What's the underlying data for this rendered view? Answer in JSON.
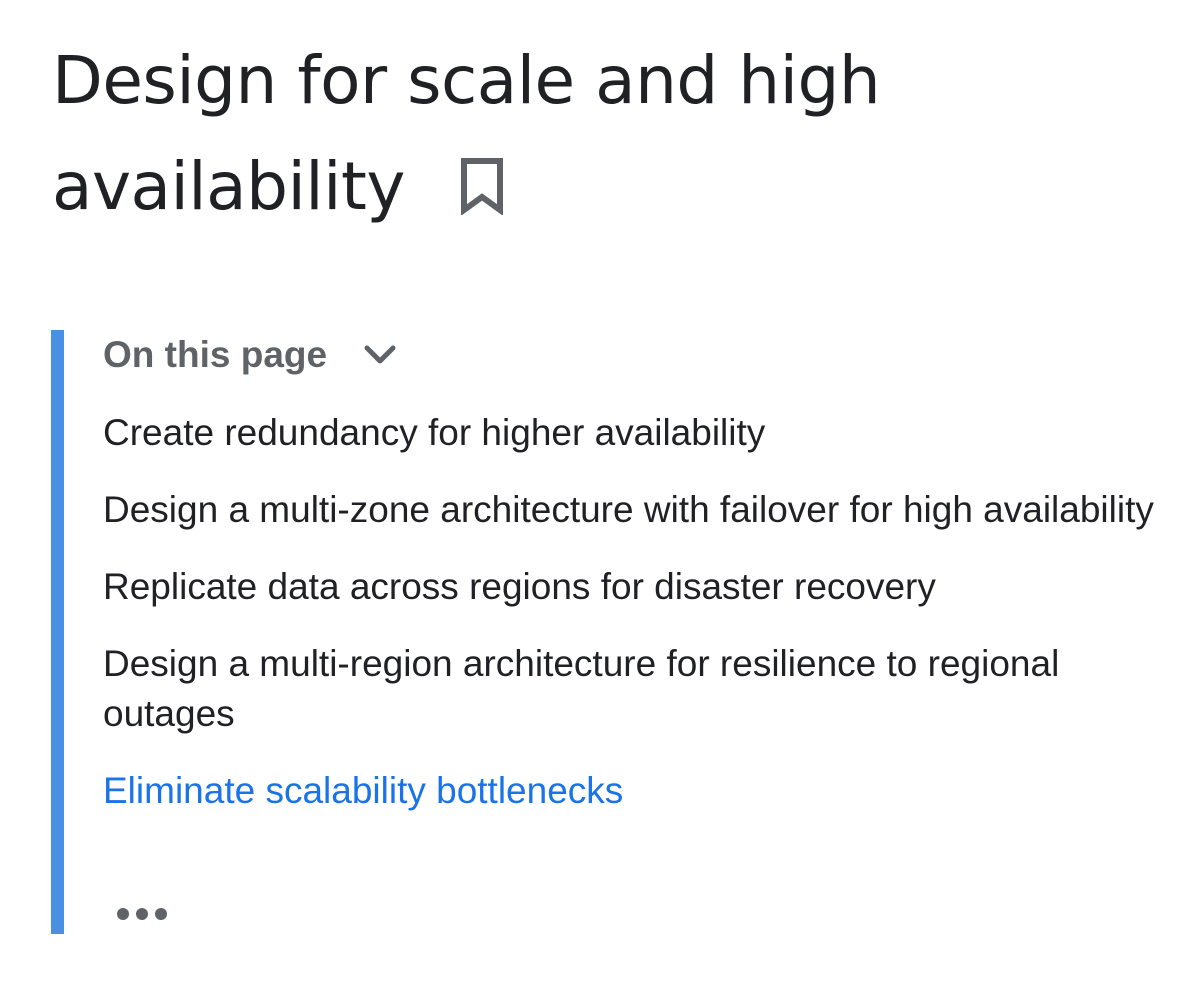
{
  "page": {
    "title": "Design for scale and high availability"
  },
  "icons": {
    "bookmark": "bookmark-outline-icon",
    "chevron": "chevron-down-icon",
    "more": "more-horizontal-icon"
  },
  "toc": {
    "header_label": "On this page",
    "items": [
      {
        "label": "Create redundancy for higher availability",
        "active": false
      },
      {
        "label": "Design a multi-zone architecture with failover for high availability",
        "active": false
      },
      {
        "label": "Replicate data across regions for disaster recovery",
        "active": false
      },
      {
        "label": "Design a multi-region architecture for resilience to regional outages",
        "active": false
      },
      {
        "label": "Eliminate scalability bottlenecks",
        "active": true
      }
    ]
  },
  "colors": {
    "accent_bar": "#4a90e2",
    "active_link": "#1a73e8",
    "text": "#202124",
    "muted": "#5f6368"
  }
}
